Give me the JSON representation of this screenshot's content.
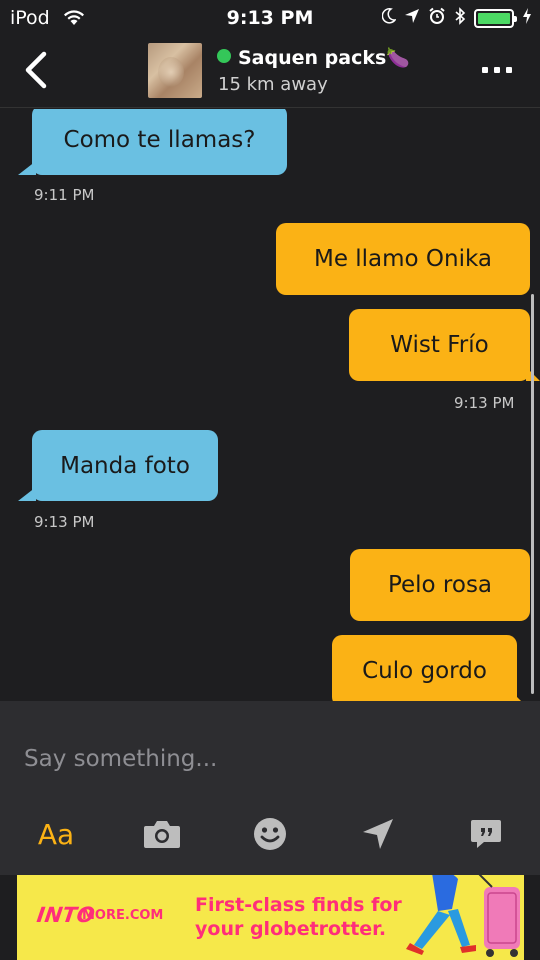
{
  "status_bar": {
    "carrier": "iPod",
    "time": "9:13 PM",
    "battery_level": 1.0,
    "icons": [
      "wifi-icon",
      "moon-icon",
      "location-icon",
      "alarm-icon",
      "bluetooth-icon",
      "battery-icon",
      "charging-icon"
    ]
  },
  "header": {
    "contact_name": "Saquen packs🍆",
    "distance": "15 km away",
    "online_color": "#34c759"
  },
  "messages": [
    {
      "direction": "in",
      "text": "Como te llamas?"
    },
    {
      "time": "9:11 PM"
    },
    {
      "direction": "out",
      "text": "Me llamo Onika"
    },
    {
      "direction": "out",
      "text": "Wist Frío"
    },
    {
      "time": "9:13 PM"
    },
    {
      "direction": "in",
      "text": "Manda foto"
    },
    {
      "time": "9:13 PM"
    },
    {
      "direction": "out",
      "text": "Pelo rosa"
    },
    {
      "direction": "out",
      "text": "Culo gordo"
    }
  ],
  "composer": {
    "placeholder": "Say something...",
    "text_tool_label": "Aa",
    "tools": [
      "camera-icon",
      "emoji-icon",
      "send-location-icon",
      "saved-phrases-icon"
    ]
  },
  "ad": {
    "logo": "INTO",
    "logo_suffix": "MORE.COM",
    "line1": "First-class finds for",
    "line2": "your globetrotter."
  },
  "colors": {
    "background": "#1e1e20",
    "incoming_bubble": "#6ac0e2",
    "outgoing_bubble": "#fbb215",
    "accent": "#fbb215",
    "ad_background": "#f6e84a",
    "ad_text": "#ff2e7a"
  }
}
